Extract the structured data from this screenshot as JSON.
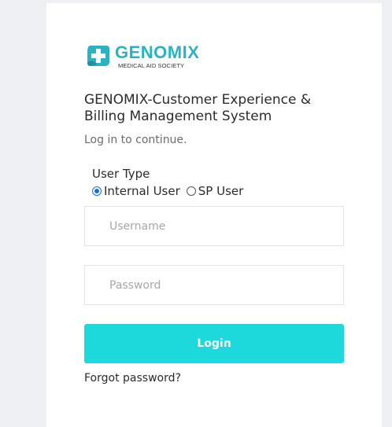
{
  "logo": {
    "brand": "GENOMIX",
    "tagline": "MEDICAL AID SOCIETY",
    "mark_icon": "medical-cross-icon"
  },
  "heading": {
    "title": "GENOMIX-Customer Experience & Billing Management System",
    "subtitle": "Log in to continue."
  },
  "user_type": {
    "label": "User Type",
    "options": [
      {
        "label": "Internal User",
        "selected": true
      },
      {
        "label": "SP User",
        "selected": false
      }
    ]
  },
  "form": {
    "username_placeholder": "Username",
    "password_placeholder": "Password",
    "login_label": "Login",
    "forgot_label": "Forgot password?"
  },
  "colors": {
    "accent": "#1ed9dc",
    "brand": "#2bb3c2",
    "background": "#eef0f4",
    "radio_selected": "#1a6fd8"
  }
}
